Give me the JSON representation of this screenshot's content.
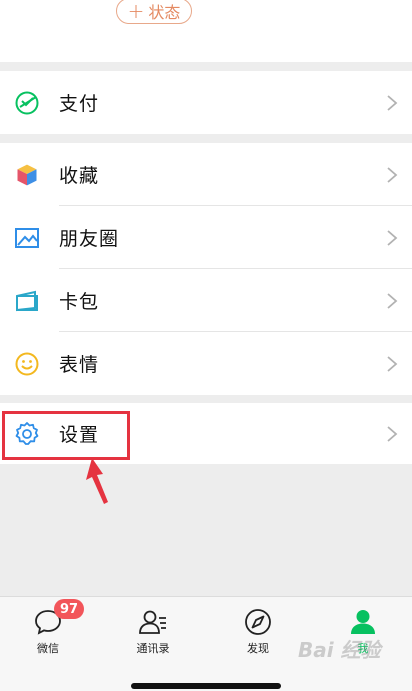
{
  "profile": {
    "status_plus": "+",
    "status_label": "状态"
  },
  "menu": {
    "pay": "支付",
    "favorites": "收藏",
    "moments": "朋友圈",
    "cards": "卡包",
    "stickers": "表情",
    "settings": "设置"
  },
  "tabbar": {
    "chats": "微信",
    "chats_badge": "97",
    "contacts": "通讯录",
    "discover": "发现",
    "me": "我"
  },
  "watermark": "Bai 经验",
  "colors": {
    "accent_green": "#07c160",
    "badge_red": "#f2555a",
    "highlight_red": "#e53340",
    "status_orange": "#e48a62"
  }
}
